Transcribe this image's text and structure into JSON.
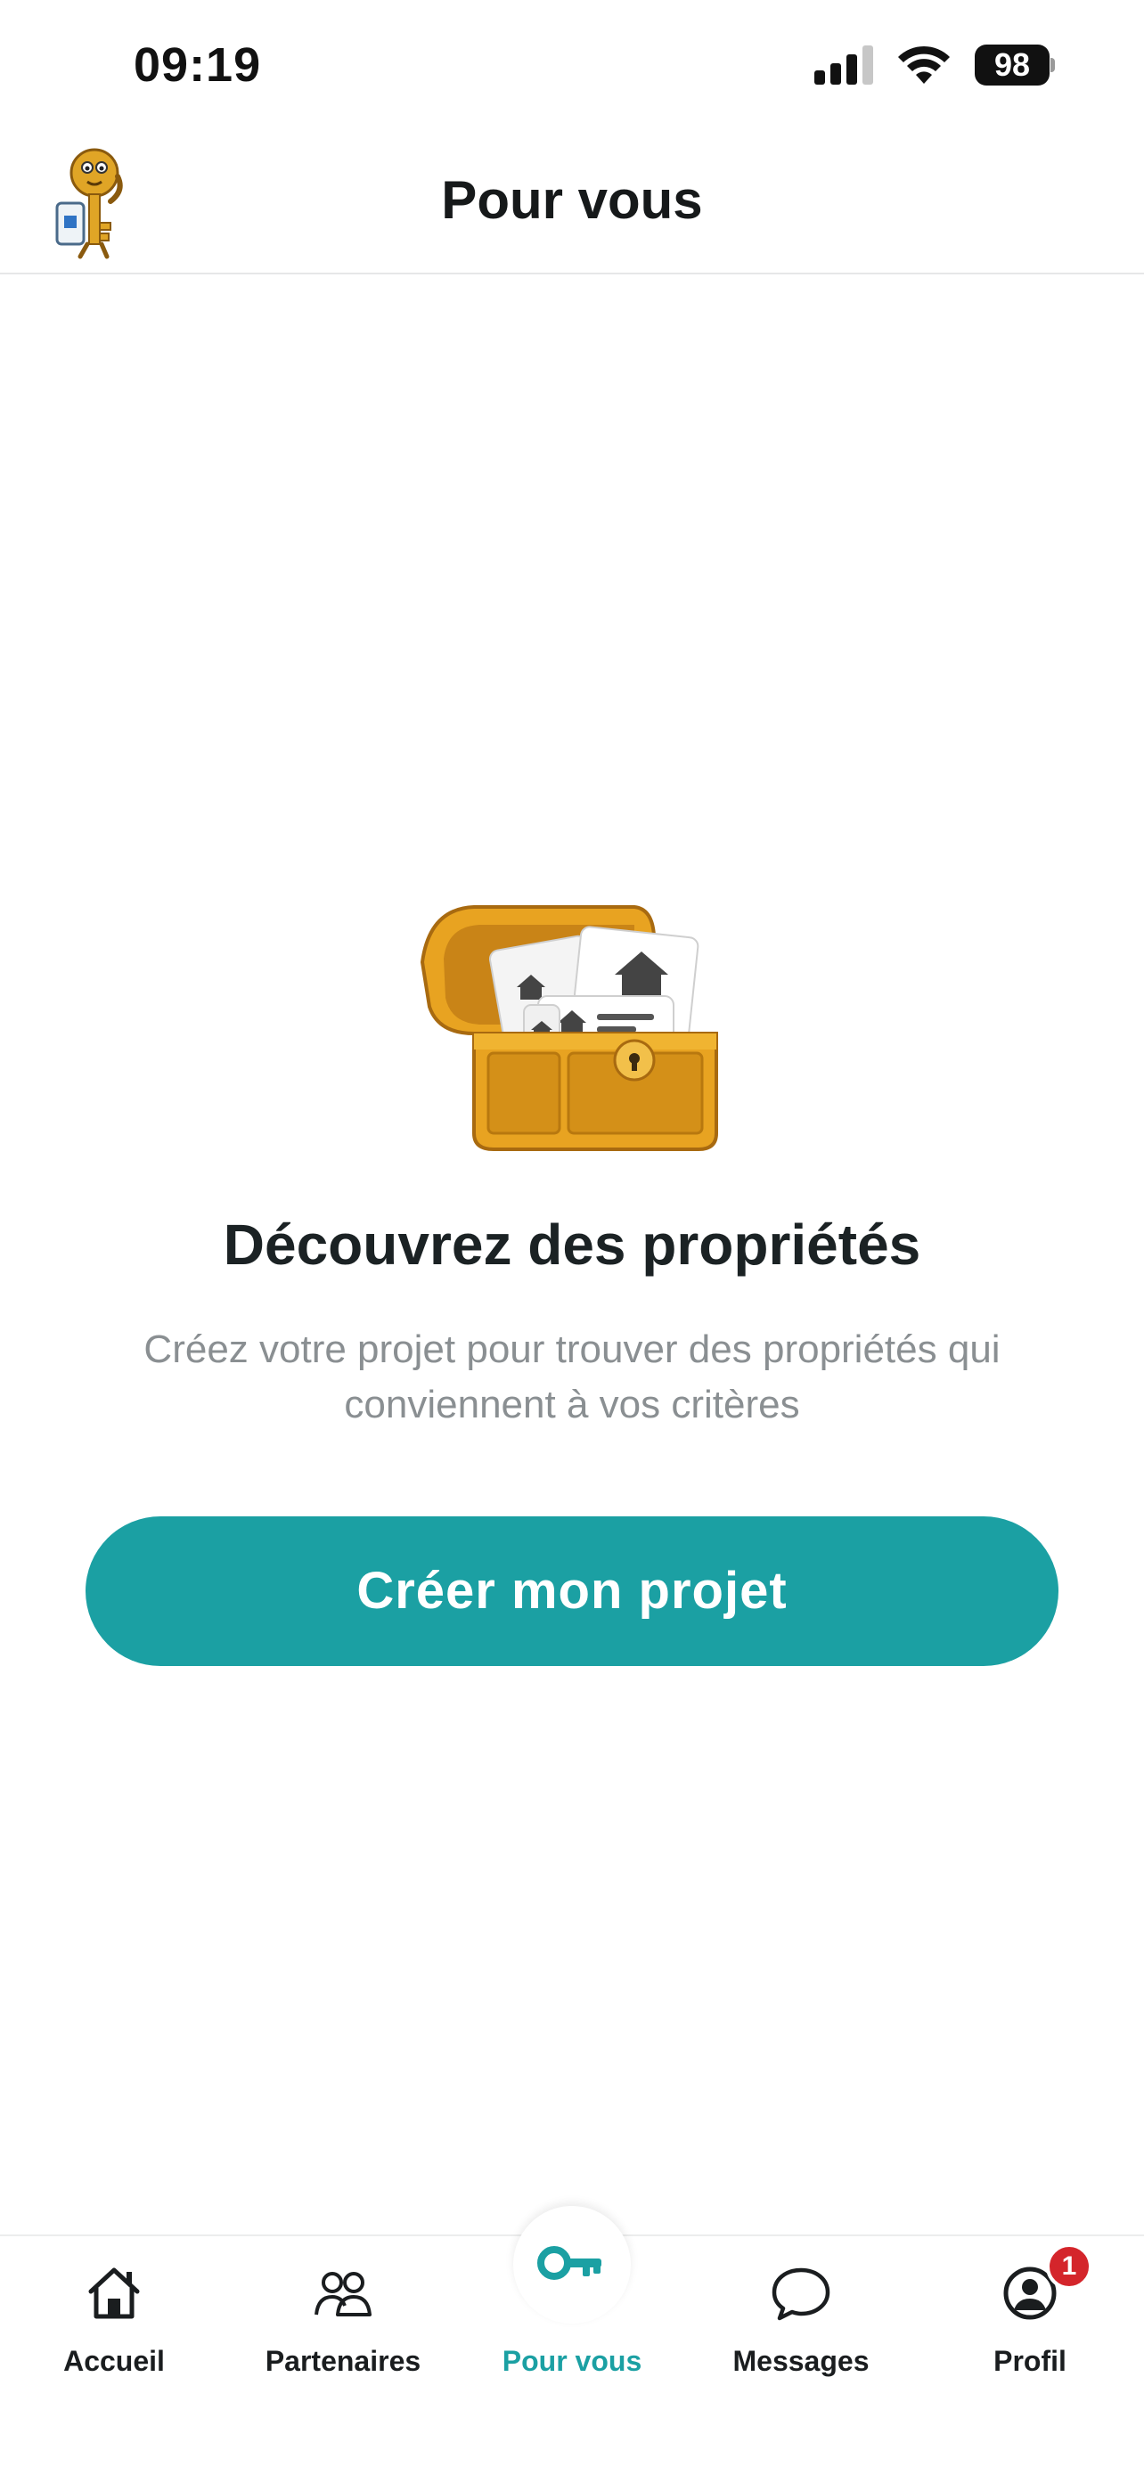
{
  "status_bar": {
    "time": "09:19",
    "battery": "98",
    "icons": [
      "signal-icon",
      "wifi-icon",
      "battery-icon"
    ]
  },
  "header": {
    "title": "Pour vous",
    "logo_icon": "key-mascot-icon"
  },
  "empty_state": {
    "illustration": "treasure-chest-icon",
    "title": "Découvrez des propriétés",
    "description": "Créez votre projet pour trouver des propriétés qui conviennent à vos critères",
    "cta_label": "Créer mon projet"
  },
  "nav": {
    "items": [
      {
        "label": "Accueil",
        "icon": "home-icon"
      },
      {
        "label": "Partenaires",
        "icon": "people-icon"
      },
      {
        "label": "Pour vous",
        "icon": "key-icon",
        "active": true
      },
      {
        "label": "Messages",
        "icon": "chat-bubble-icon"
      },
      {
        "label": "Profil",
        "icon": "profile-icon",
        "badge": "1"
      }
    ]
  },
  "colors": {
    "accent": "#1ba0a3",
    "badge": "#d4252b",
    "text": "#1b2224",
    "muted": "#8a8f92"
  }
}
